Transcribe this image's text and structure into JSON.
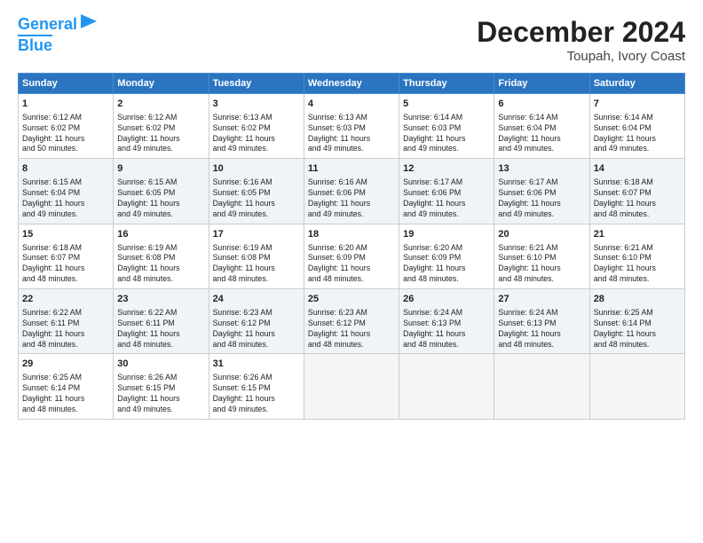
{
  "header": {
    "logo_line1": "General",
    "logo_line2": "Blue",
    "main_title": "December 2024",
    "subtitle": "Toupah, Ivory Coast"
  },
  "days_of_week": [
    "Sunday",
    "Monday",
    "Tuesday",
    "Wednesday",
    "Thursday",
    "Friday",
    "Saturday"
  ],
  "weeks": [
    [
      {
        "day": 1,
        "lines": [
          "Sunrise: 6:12 AM",
          "Sunset: 6:02 PM",
          "Daylight: 11 hours",
          "and 50 minutes."
        ]
      },
      {
        "day": 2,
        "lines": [
          "Sunrise: 6:12 AM",
          "Sunset: 6:02 PM",
          "Daylight: 11 hours",
          "and 49 minutes."
        ]
      },
      {
        "day": 3,
        "lines": [
          "Sunrise: 6:13 AM",
          "Sunset: 6:02 PM",
          "Daylight: 11 hours",
          "and 49 minutes."
        ]
      },
      {
        "day": 4,
        "lines": [
          "Sunrise: 6:13 AM",
          "Sunset: 6:03 PM",
          "Daylight: 11 hours",
          "and 49 minutes."
        ]
      },
      {
        "day": 5,
        "lines": [
          "Sunrise: 6:14 AM",
          "Sunset: 6:03 PM",
          "Daylight: 11 hours",
          "and 49 minutes."
        ]
      },
      {
        "day": 6,
        "lines": [
          "Sunrise: 6:14 AM",
          "Sunset: 6:04 PM",
          "Daylight: 11 hours",
          "and 49 minutes."
        ]
      },
      {
        "day": 7,
        "lines": [
          "Sunrise: 6:14 AM",
          "Sunset: 6:04 PM",
          "Daylight: 11 hours",
          "and 49 minutes."
        ]
      }
    ],
    [
      {
        "day": 8,
        "lines": [
          "Sunrise: 6:15 AM",
          "Sunset: 6:04 PM",
          "Daylight: 11 hours",
          "and 49 minutes."
        ]
      },
      {
        "day": 9,
        "lines": [
          "Sunrise: 6:15 AM",
          "Sunset: 6:05 PM",
          "Daylight: 11 hours",
          "and 49 minutes."
        ]
      },
      {
        "day": 10,
        "lines": [
          "Sunrise: 6:16 AM",
          "Sunset: 6:05 PM",
          "Daylight: 11 hours",
          "and 49 minutes."
        ]
      },
      {
        "day": 11,
        "lines": [
          "Sunrise: 6:16 AM",
          "Sunset: 6:06 PM",
          "Daylight: 11 hours",
          "and 49 minutes."
        ]
      },
      {
        "day": 12,
        "lines": [
          "Sunrise: 6:17 AM",
          "Sunset: 6:06 PM",
          "Daylight: 11 hours",
          "and 49 minutes."
        ]
      },
      {
        "day": 13,
        "lines": [
          "Sunrise: 6:17 AM",
          "Sunset: 6:06 PM",
          "Daylight: 11 hours",
          "and 49 minutes."
        ]
      },
      {
        "day": 14,
        "lines": [
          "Sunrise: 6:18 AM",
          "Sunset: 6:07 PM",
          "Daylight: 11 hours",
          "and 48 minutes."
        ]
      }
    ],
    [
      {
        "day": 15,
        "lines": [
          "Sunrise: 6:18 AM",
          "Sunset: 6:07 PM",
          "Daylight: 11 hours",
          "and 48 minutes."
        ]
      },
      {
        "day": 16,
        "lines": [
          "Sunrise: 6:19 AM",
          "Sunset: 6:08 PM",
          "Daylight: 11 hours",
          "and 48 minutes."
        ]
      },
      {
        "day": 17,
        "lines": [
          "Sunrise: 6:19 AM",
          "Sunset: 6:08 PM",
          "Daylight: 11 hours",
          "and 48 minutes."
        ]
      },
      {
        "day": 18,
        "lines": [
          "Sunrise: 6:20 AM",
          "Sunset: 6:09 PM",
          "Daylight: 11 hours",
          "and 48 minutes."
        ]
      },
      {
        "day": 19,
        "lines": [
          "Sunrise: 6:20 AM",
          "Sunset: 6:09 PM",
          "Daylight: 11 hours",
          "and 48 minutes."
        ]
      },
      {
        "day": 20,
        "lines": [
          "Sunrise: 6:21 AM",
          "Sunset: 6:10 PM",
          "Daylight: 11 hours",
          "and 48 minutes."
        ]
      },
      {
        "day": 21,
        "lines": [
          "Sunrise: 6:21 AM",
          "Sunset: 6:10 PM",
          "Daylight: 11 hours",
          "and 48 minutes."
        ]
      }
    ],
    [
      {
        "day": 22,
        "lines": [
          "Sunrise: 6:22 AM",
          "Sunset: 6:11 PM",
          "Daylight: 11 hours",
          "and 48 minutes."
        ]
      },
      {
        "day": 23,
        "lines": [
          "Sunrise: 6:22 AM",
          "Sunset: 6:11 PM",
          "Daylight: 11 hours",
          "and 48 minutes."
        ]
      },
      {
        "day": 24,
        "lines": [
          "Sunrise: 6:23 AM",
          "Sunset: 6:12 PM",
          "Daylight: 11 hours",
          "and 48 minutes."
        ]
      },
      {
        "day": 25,
        "lines": [
          "Sunrise: 6:23 AM",
          "Sunset: 6:12 PM",
          "Daylight: 11 hours",
          "and 48 minutes."
        ]
      },
      {
        "day": 26,
        "lines": [
          "Sunrise: 6:24 AM",
          "Sunset: 6:13 PM",
          "Daylight: 11 hours",
          "and 48 minutes."
        ]
      },
      {
        "day": 27,
        "lines": [
          "Sunrise: 6:24 AM",
          "Sunset: 6:13 PM",
          "Daylight: 11 hours",
          "and 48 minutes."
        ]
      },
      {
        "day": 28,
        "lines": [
          "Sunrise: 6:25 AM",
          "Sunset: 6:14 PM",
          "Daylight: 11 hours",
          "and 48 minutes."
        ]
      }
    ],
    [
      {
        "day": 29,
        "lines": [
          "Sunrise: 6:25 AM",
          "Sunset: 6:14 PM",
          "Daylight: 11 hours",
          "and 48 minutes."
        ]
      },
      {
        "day": 30,
        "lines": [
          "Sunrise: 6:26 AM",
          "Sunset: 6:15 PM",
          "Daylight: 11 hours",
          "and 49 minutes."
        ]
      },
      {
        "day": 31,
        "lines": [
          "Sunrise: 6:26 AM",
          "Sunset: 6:15 PM",
          "Daylight: 11 hours",
          "and 49 minutes."
        ]
      },
      null,
      null,
      null,
      null
    ]
  ]
}
